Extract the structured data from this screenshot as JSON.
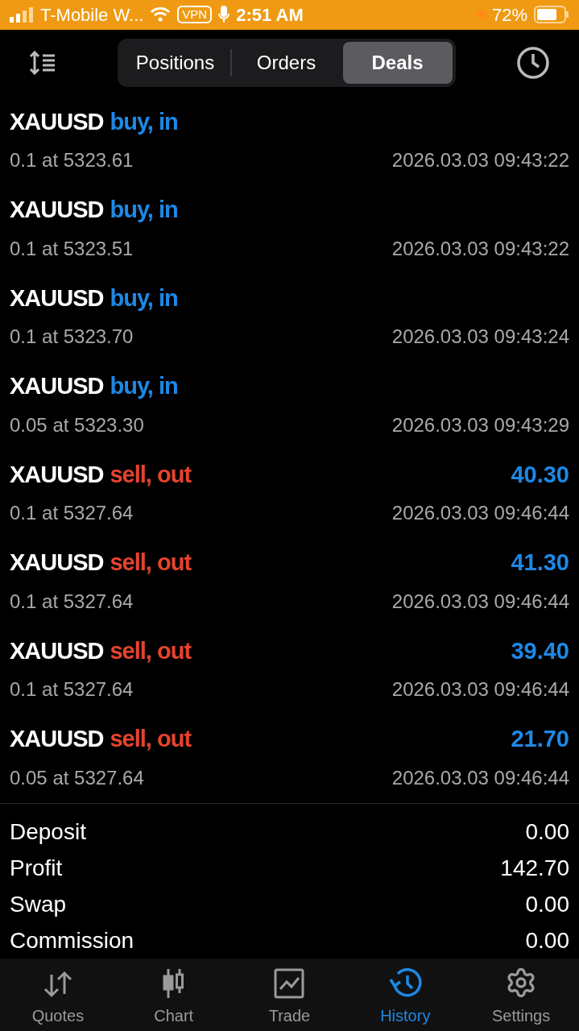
{
  "status_bar": {
    "carrier": "T-Mobile W...",
    "vpn": "VPN",
    "time": "2:51 AM",
    "battery": "72%"
  },
  "tabs": [
    {
      "label": "Positions",
      "selected": false
    },
    {
      "label": "Orders",
      "selected": false
    },
    {
      "label": "Deals",
      "selected": true
    }
  ],
  "deals": [
    {
      "symbol": "XAUUSD",
      "kind": "buy",
      "action": "buy, in",
      "volume": "0.1 at 5323.61",
      "time": "2026.03.03 09:43:22"
    },
    {
      "symbol": "XAUUSD",
      "kind": "buy",
      "action": "buy, in",
      "volume": "0.1 at 5323.51",
      "time": "2026.03.03 09:43:22"
    },
    {
      "symbol": "XAUUSD",
      "kind": "buy",
      "action": "buy, in",
      "volume": "0.1 at 5323.70",
      "time": "2026.03.03 09:43:24"
    },
    {
      "symbol": "XAUUSD",
      "kind": "buy",
      "action": "buy, in",
      "volume": "0.05 at 5323.30",
      "time": "2026.03.03 09:43:29"
    },
    {
      "symbol": "XAUUSD",
      "kind": "sell",
      "action": "sell, out",
      "profit": "40.30",
      "volume": "0.1 at 5327.64",
      "time": "2026.03.03 09:46:44"
    },
    {
      "symbol": "XAUUSD",
      "kind": "sell",
      "action": "sell, out",
      "profit": "41.30",
      "volume": "0.1 at 5327.64",
      "time": "2026.03.03 09:46:44"
    },
    {
      "symbol": "XAUUSD",
      "kind": "sell",
      "action": "sell, out",
      "profit": "39.40",
      "volume": "0.1 at 5327.64",
      "time": "2026.03.03 09:46:44"
    },
    {
      "symbol": "XAUUSD",
      "kind": "sell",
      "action": "sell, out",
      "profit": "21.70",
      "volume": "0.05 at 5327.64",
      "time": "2026.03.03 09:46:44"
    }
  ],
  "summary": [
    {
      "label": "Deposit",
      "value": "0.00"
    },
    {
      "label": "Profit",
      "value": "142.70"
    },
    {
      "label": "Swap",
      "value": "0.00"
    },
    {
      "label": "Commission",
      "value": "0.00"
    }
  ],
  "bottom_nav": [
    {
      "label": "Quotes",
      "kind": "quotes",
      "selected": false
    },
    {
      "label": "Chart",
      "kind": "chart",
      "selected": false
    },
    {
      "label": "Trade",
      "kind": "trade",
      "selected": false
    },
    {
      "label": "History",
      "kind": "history",
      "selected": true
    },
    {
      "label": "Settings",
      "kind": "settings",
      "selected": false
    }
  ]
}
